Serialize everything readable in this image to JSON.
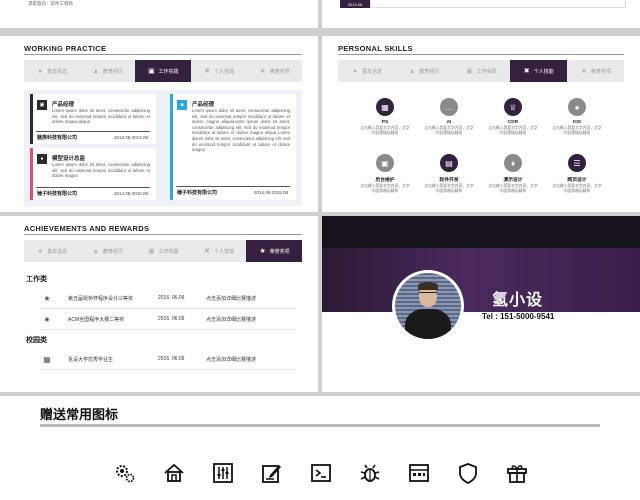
{
  "top_left": {
    "text": "求职意向：软件工程师"
  },
  "top_right": {
    "date": "2014.06"
  },
  "tabs": [
    {
      "label": "基本信息",
      "icon": "user-icon"
    },
    {
      "label": "教育经历",
      "icon": "graduation-cap-icon"
    },
    {
      "label": "工作实践",
      "icon": "briefcase-icon"
    },
    {
      "label": "个人技能",
      "icon": "tools-icon"
    },
    {
      "label": "荣誉奖项",
      "icon": "trophy-icon"
    }
  ],
  "work": {
    "title": "WORKING PRACTICE",
    "jobs": [
      {
        "title": "产品经理",
        "desc": "Lorem ipsum dolor sit amet, consectetur adipiscing elit, sed do eiusmod tempor incididunt ut labore et dolore magna aliqua",
        "company": "魅族科技有限公司",
        "date": "2013.06-2013.08",
        "color": "#2a2a2a"
      },
      {
        "title": "模型设计总监",
        "desc": "Lorem ipsum dolor sit amet, consectetur adipiscing elit, sed do eiusmod tempor incididunt ut labore et dolore magna",
        "company": "锤子科技有限公司",
        "date": "2014.06-2015.08",
        "color": "#e84d6e"
      },
      {
        "title": "产品经理",
        "desc": "Lorem ipsum dolor sit amet, consectetur adipiscing elit, sed do eiusmod tempor incididunt ut labore et dolore magna aliquaLorem ipsum dolor sit amet, consectetur adipiscing elit, sed do eiusmod tempor incididunt ut labore et dolore magna aliqua Lorem ipsum dolor sit amet, consectetur adipiscing elit, sed do eiusmod tempor incididunt ut labore et dolore magna",
        "company": "锤子科技有限公司",
        "date": "2014.06-2015.08",
        "color": "#29a8e0"
      }
    ]
  },
  "skills": {
    "title": "PERSONAL SKILLS",
    "items": [
      {
        "name": "PS",
        "desc": "点击输入简要文字内容，文字内容需概括精炼",
        "icon": "ps-icon"
      },
      {
        "name": "AI",
        "desc": "点击输入简要文字内容，文字内容需概括精炼",
        "icon": "chat-icon"
      },
      {
        "name": "CDR",
        "desc": "点击输入简要文字内容，文字内容需概括精炼",
        "icon": "crown-icon"
      },
      {
        "name": "IOS",
        "desc": "点击输入简要文字内容，文字内容需概括精炼",
        "icon": "apple-icon"
      },
      {
        "name": "后台维护",
        "desc": "点击输入简要文字内容，文字内容需概括精炼",
        "icon": "bag-icon"
      },
      {
        "name": "软件开发",
        "desc": "点击输入简要文字内容，文字内容需概括精炼",
        "icon": "inbox-icon"
      },
      {
        "name": "演示设计",
        "desc": "点击输入简要文字内容，文字内容需概括精炼",
        "icon": "drop-icon"
      },
      {
        "name": "网页设计",
        "desc": "点击输入简要文字内容，文字内容需概括精炼",
        "icon": "layers-icon"
      }
    ]
  },
  "achievements": {
    "title": "ACHIEVEMENTS AND REWARDS",
    "work_label": "工作类",
    "school_label": "校园类",
    "work_items": [
      {
        "name": "第五届昆桥杯程序设计三等奖",
        "date": "2016. 06.09",
        "desc": "点击添加详细比赛描述",
        "icon": "trophy-icon"
      },
      {
        "name": "ACM全国程序大赛二等奖",
        "date": "2016. 06.09",
        "desc": "点击添加详细比赛描述",
        "icon": "trophy-icon"
      }
    ],
    "school_items": [
      {
        "name": "氢设大学优秀毕业生",
        "date": "2016. 06.09",
        "desc": "点击添加详细比赛描述",
        "icon": "building-icon"
      }
    ]
  },
  "profile": {
    "name": "氢小设",
    "tel": "Tel : 151-5000-9541"
  },
  "icons_section": {
    "title": "赠送常用图标",
    "icons": [
      "gears-icon",
      "home-icon",
      "equalizer-icon",
      "edit-icon",
      "terminal-icon",
      "bug-icon",
      "panel-icon",
      "shield-icon",
      "gift-icon"
    ]
  },
  "colors": {
    "accent": "#34213f",
    "pink": "#e84d6e",
    "blue": "#29a8e0",
    "skill_dark": "#34213f",
    "skill_gray": "#8a8a8a"
  }
}
